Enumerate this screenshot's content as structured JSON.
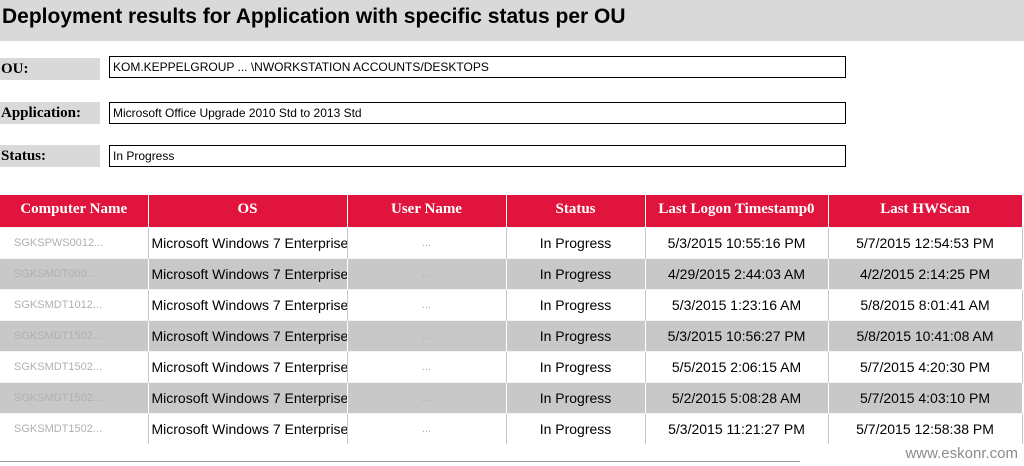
{
  "report": {
    "title": "Deployment results for Application with specific status per OU"
  },
  "fields": {
    "ou": {
      "label": "OU:",
      "value": "KOM.KEPPELGROUP ... \\NWORKSTATION ACCOUNTS/DESKTOPS"
    },
    "application": {
      "label": "Application:",
      "value": "Microsoft Office Upgrade 2010 Std to 2013 Std"
    },
    "status": {
      "label": "Status:",
      "value": "In Progress"
    }
  },
  "table": {
    "columns": [
      "Computer Name",
      "OS",
      "User Name",
      "Status",
      "Last Logon Timestamp0",
      "Last HWScan"
    ],
    "rows": [
      {
        "computer": "SGKSPWS0012...",
        "os": "Microsoft Windows 7 Enterprise",
        "user": "...",
        "status": "In Progress",
        "last_logon": "5/3/2015 10:55:16 PM",
        "last_hwscan": "5/7/2015 12:54:53 PM"
      },
      {
        "computer": "SGKSMDT000...",
        "os": "Microsoft Windows 7 Enterprise",
        "user": "...",
        "status": "In Progress",
        "last_logon": "4/29/2015 2:44:03 AM",
        "last_hwscan": "4/2/2015 2:14:25 PM"
      },
      {
        "computer": "SGKSMDT1012...",
        "os": "Microsoft Windows 7 Enterprise",
        "user": "...",
        "status": "In Progress",
        "last_logon": "5/3/2015 1:23:16 AM",
        "last_hwscan": "5/8/2015 8:01:41 AM"
      },
      {
        "computer": "SGKSMDT1502...",
        "os": "Microsoft Windows 7 Enterprise",
        "user": "...",
        "status": "In Progress",
        "last_logon": "5/3/2015 10:56:27 PM",
        "last_hwscan": "5/8/2015 10:41:08 AM"
      },
      {
        "computer": "SGKSMDT1502...",
        "os": "Microsoft Windows 7 Enterprise",
        "user": "...",
        "status": "In Progress",
        "last_logon": "5/5/2015 2:06:15 AM",
        "last_hwscan": "5/7/2015 4:20:30 PM"
      },
      {
        "computer": "SGKSMDT1502...",
        "os": "Microsoft Windows 7 Enterprise",
        "user": "...",
        "status": "In Progress",
        "last_logon": "5/2/2015 5:08:28 AM",
        "last_hwscan": "5/7/2015 4:03:10 PM"
      },
      {
        "computer": "SGKSMDT1502...",
        "os": "Microsoft Windows 7 Enterprise",
        "user": "...",
        "status": "In Progress",
        "last_logon": "5/3/2015 11:21:27 PM",
        "last_hwscan": "5/7/2015 12:58:38 PM"
      }
    ]
  },
  "watermark": "www.eskonr.com",
  "colors": {
    "header_bg": "#e0143c",
    "title_bg": "#d9d9d9",
    "alt_row_bg": "#c8c8c8"
  }
}
